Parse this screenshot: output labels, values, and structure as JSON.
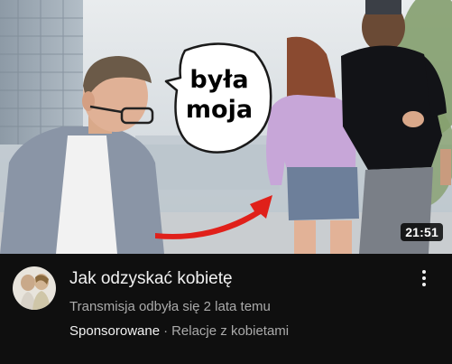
{
  "thumbnail": {
    "speech_bubble_lines": [
      "była",
      "moja"
    ],
    "duration": "21:51"
  },
  "video": {
    "title": "Jak odzyskać kobietę",
    "subtitle": "Transmisja odbyła się 2 lata temu",
    "sponsored_label": "Sponsorowane",
    "separator": "·",
    "channel": "Relacje z kobietami"
  },
  "icons": {
    "more": "more-vert-icon",
    "avatar": "channel-avatar"
  },
  "colors": {
    "background": "#0f0f0f",
    "title": "#f1f1f1",
    "secondary_text": "#aaaaaa",
    "arrow": "#e0201a"
  }
}
